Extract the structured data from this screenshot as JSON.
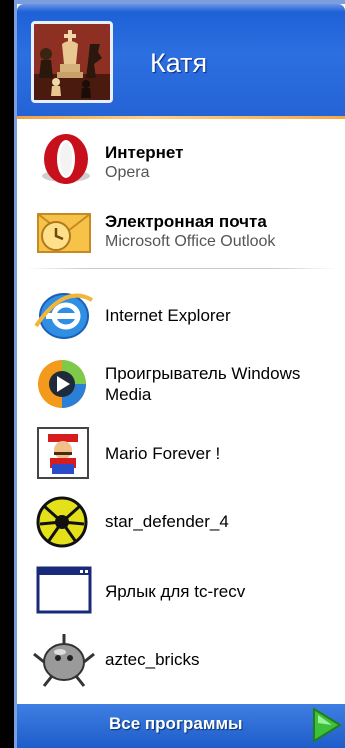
{
  "user": {
    "name": "Катя"
  },
  "pinned": [
    {
      "title": "Интернет",
      "subtitle": "Opera"
    },
    {
      "title": "Электронная почта",
      "subtitle": "Microsoft Office Outlook"
    }
  ],
  "recent": [
    {
      "line1": "Internet Explorer"
    },
    {
      "line1": "Проигрыватель Windows",
      "line2": "Media"
    },
    {
      "line1": "Mario Forever !"
    },
    {
      "line1": "star_defender_4"
    },
    {
      "line1": "Ярлык для tc-recv"
    },
    {
      "line1": "aztec_bricks"
    }
  ],
  "all_programs": {
    "label": "Все программы"
  },
  "colors": {
    "header_blue": "#2c6fe0",
    "accent_orange": "#f2a040",
    "go_green": "#3ec13a"
  }
}
